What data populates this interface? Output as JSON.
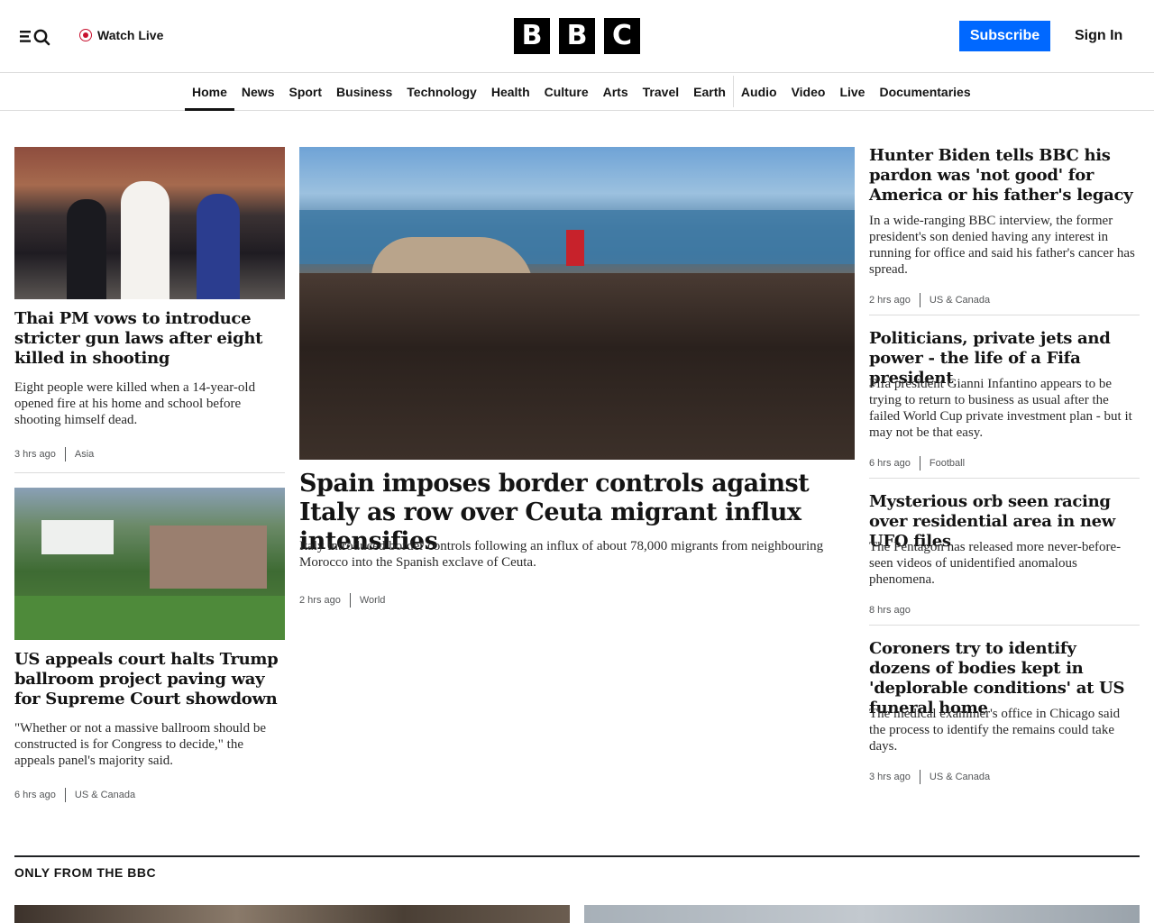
{
  "header": {
    "watch_live": "Watch Live",
    "logo": [
      "B",
      "B",
      "C"
    ],
    "subscribe": "Subscribe",
    "sign_in": "Sign In",
    "accent_color": "#0068ff",
    "live_color": "#c8102e"
  },
  "nav": {
    "items": [
      "Home",
      "News",
      "Sport",
      "Business",
      "Technology",
      "Health",
      "Culture",
      "Arts",
      "Travel",
      "Earth",
      "Audio",
      "Video",
      "Live",
      "Documentaries"
    ],
    "active": "Home"
  },
  "stories": {
    "thai": {
      "headline": "Thai PM vows to introduce stricter gun laws after eight killed in shooting",
      "summary": "Eight people were killed when a 14-year-old opened fire at his home and school before shooting himself dead.",
      "time": "3 hrs ago",
      "tag": "Asia"
    },
    "trump": {
      "headline": "US appeals court halts Trump ballroom project paving way for Supreme Court showdown",
      "summary": "\"Whether or not a massive ballroom should be constructed is for Congress to decide,\" the appeals panel's majority said.",
      "time": "6 hrs ago",
      "tag": "US & Canada"
    },
    "main": {
      "headline": "Spain imposes border controls against Italy as row over Ceuta migrant influx intensifies",
      "summary": "Italy introduced border controls following an influx of about 78,000 migrants from neighbouring Morocco into the Spanish exclave of Ceuta.",
      "time": "2 hrs ago",
      "tag": "World"
    },
    "hunter": {
      "headline": "Hunter Biden tells BBC his pardon was 'not good' for America or his father's legacy",
      "summary": "In a wide-ranging BBC interview, the former president's son denied having any interest in running for office and said his father's cancer has spread.",
      "time": "2 hrs ago",
      "tag": "US & Canada"
    },
    "fifa": {
      "headline": "Politicians, private jets and power - the life of a Fifa president",
      "summary": "Fifa president Gianni Infantino appears to be trying to return to business as usual after the failed World Cup private investment plan - but it may not be that easy.",
      "time": "6 hrs ago",
      "tag": "Football"
    },
    "ufo": {
      "headline": "Mysterious orb seen racing over residential area in new UFO files",
      "summary": "The Pentagon has released more never-before-seen videos of unidentified anomalous phenomena.",
      "time": "8 hrs ago"
    },
    "coroners": {
      "headline": "Coroners try to identify dozens of bodies kept in 'deplorable conditions' at US funeral home",
      "summary": "The medical examiner's office in Chicago said the process to identify the remains could take days.",
      "time": "3 hrs ago",
      "tag": "US & Canada"
    }
  },
  "section": {
    "title": "ONLY FROM THE BBC"
  }
}
